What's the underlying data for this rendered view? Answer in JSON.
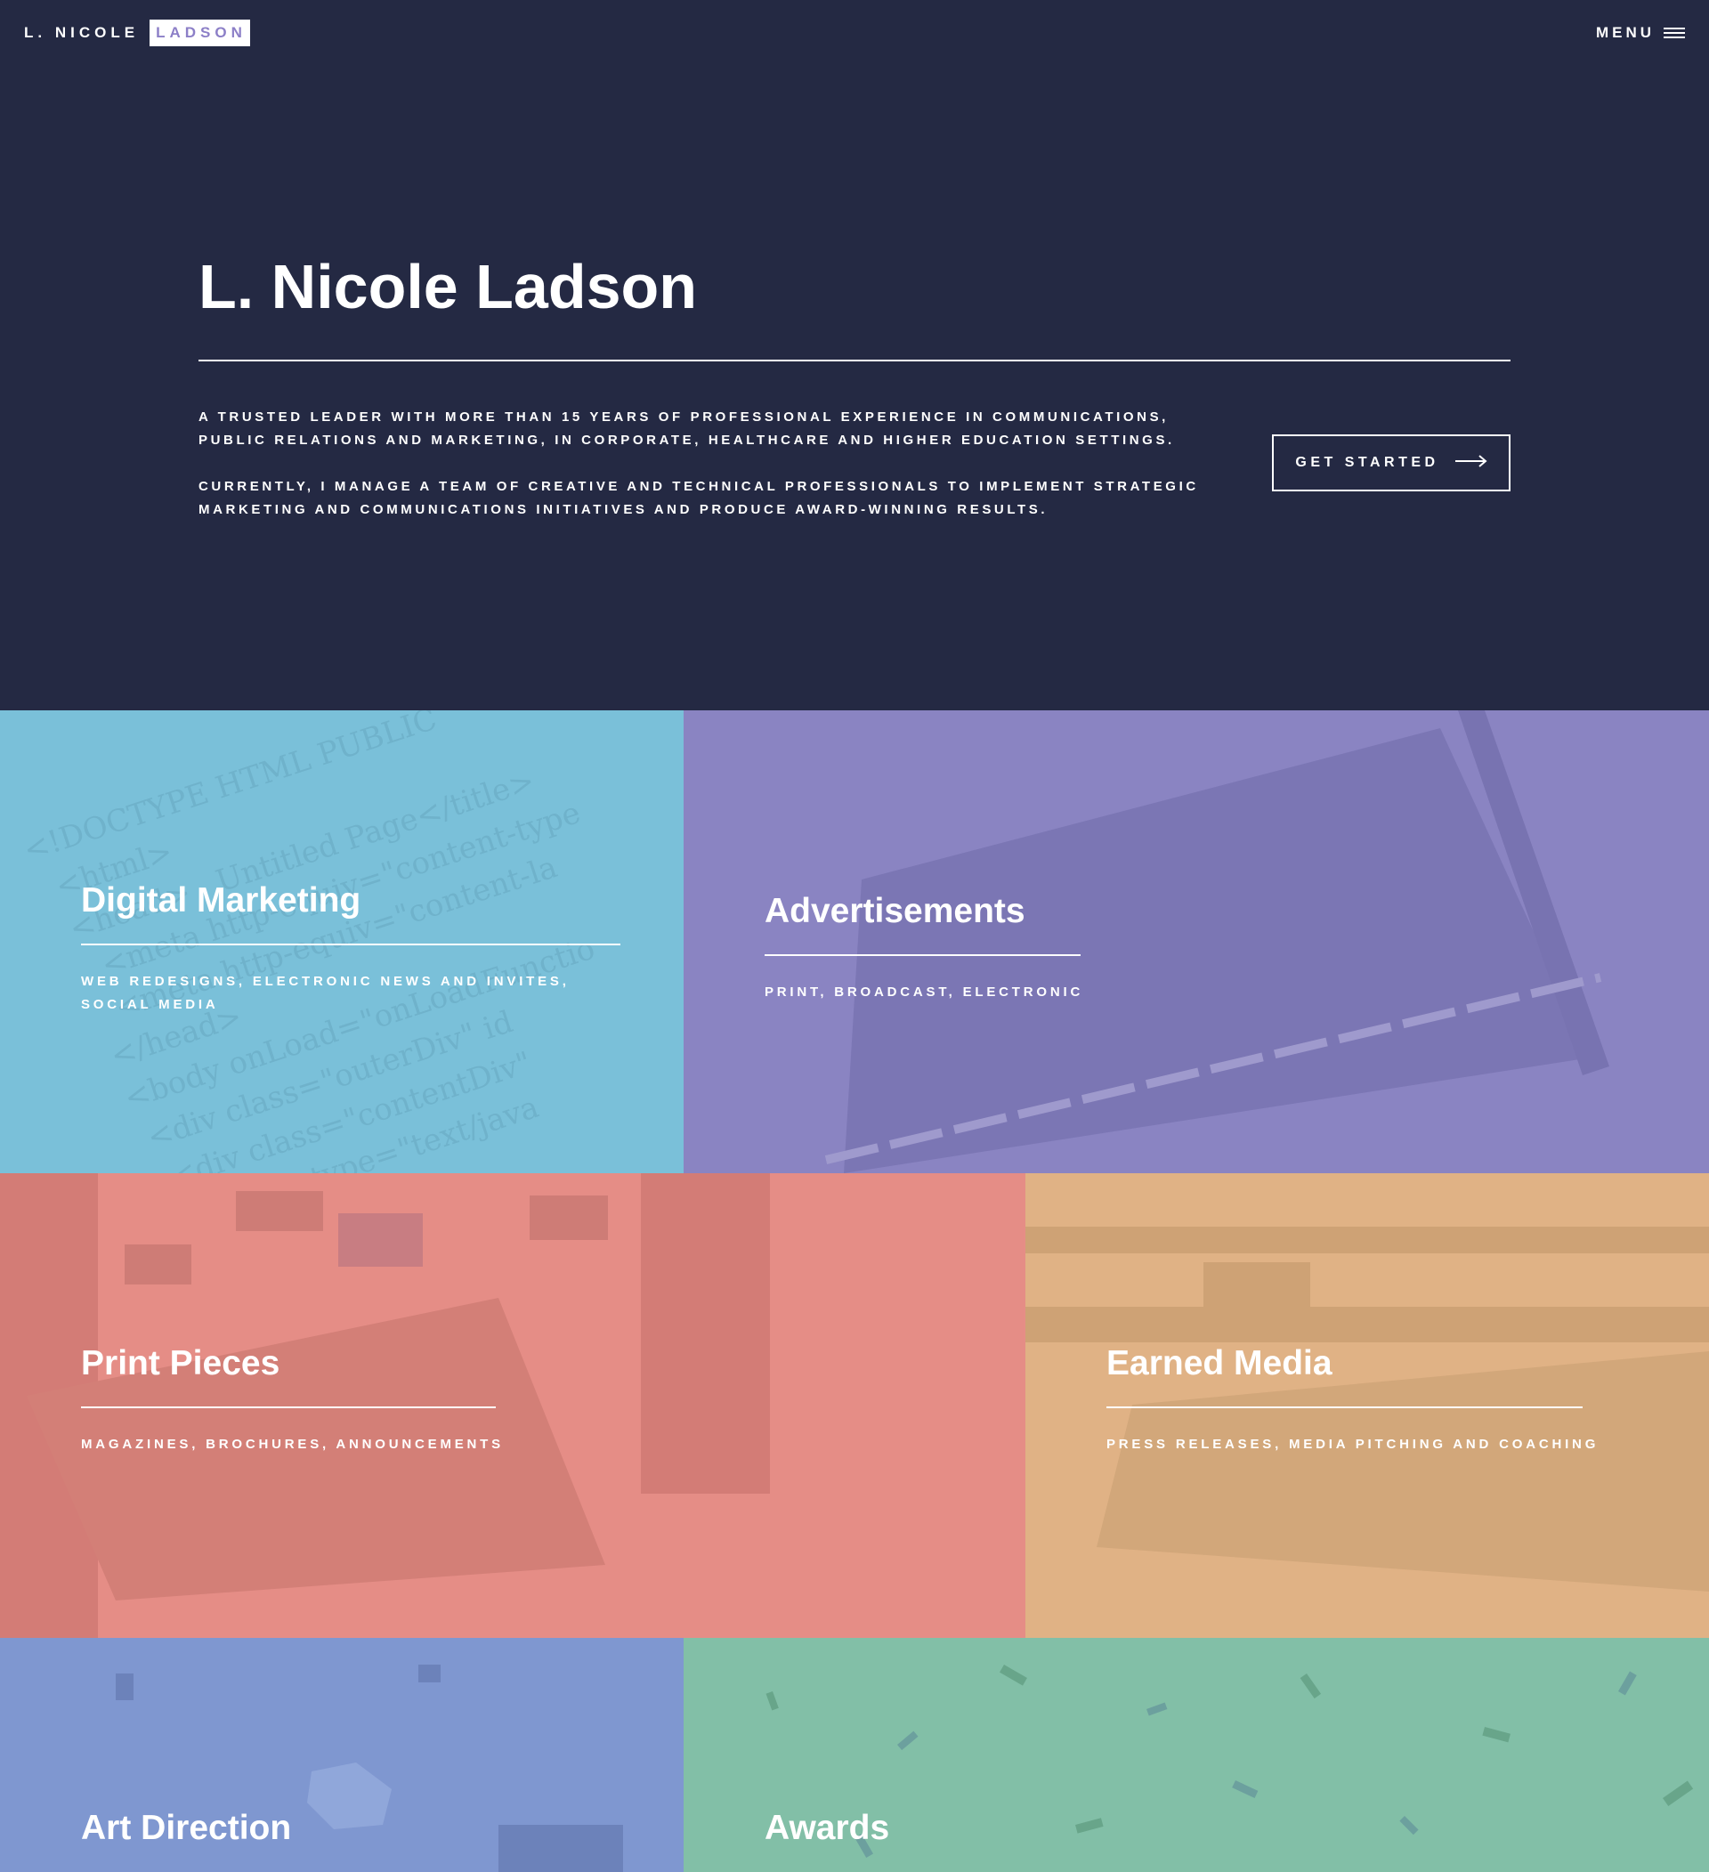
{
  "header": {
    "logo_first": "L. NICOLE",
    "logo_last": "LADSON",
    "menu_label": "MENU",
    "menu_icon": "hamburger-icon"
  },
  "banner": {
    "title": "L. Nicole Ladson",
    "paragraphs": [
      "A trusted leader with more than 15 years of professional experience in communications, public relations and marketing, in corporate, healthcare and higher education settings.",
      "Currently, I manage a team of creative and technical professionals to implement strategic marketing and communications initiatives and produce award-winning results."
    ],
    "cta_label": "GET STARTED",
    "cta_icon": "arrow-right-icon"
  },
  "tiles": [
    {
      "title": "Digital Marketing",
      "description": "Web redesigns, electronic news and invites, social media",
      "color": "#7ac0d9"
    },
    {
      "title": "Advertisements",
      "description": "Print, broadcast, electronic",
      "color": "#8a84c2"
    },
    {
      "title": "Print Pieces",
      "description": "Magazines, brochures, announcements",
      "color": "#e58d86"
    },
    {
      "title": "Earned Media",
      "description": "Press releases, media pitching and coaching",
      "color": "#e0b285"
    },
    {
      "title": "Art Direction",
      "description": "",
      "color": "#7f97d0"
    },
    {
      "title": "Awards",
      "description": "",
      "color": "#82bfa7"
    }
  ],
  "colors": {
    "banner_bg": "#242943",
    "logo_last_text": "#8c7fc7"
  }
}
